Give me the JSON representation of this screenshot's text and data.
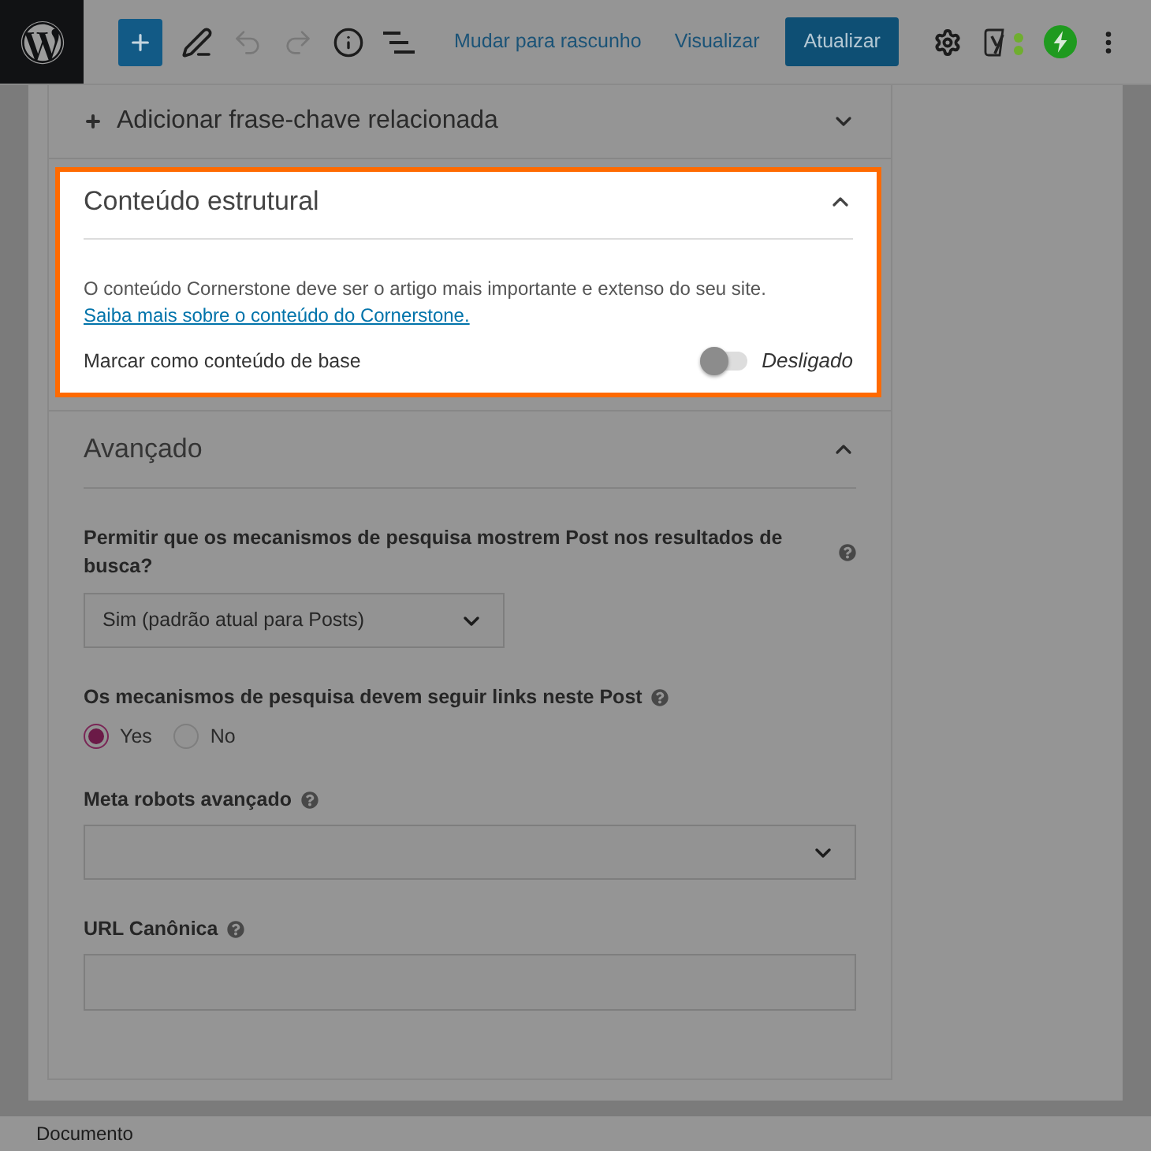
{
  "toolbar": {
    "tools": [
      {
        "kind": "edit",
        "disabled": false
      },
      {
        "kind": "undo",
        "disabled": true
      },
      {
        "kind": "redo",
        "disabled": true
      },
      {
        "kind": "info",
        "disabled": false
      },
      {
        "kind": "list",
        "disabled": false
      }
    ],
    "links": [
      {
        "label": "Mudar para rascunho"
      },
      {
        "label": "Visualizar"
      }
    ],
    "primary_button": {
      "label": "Atualizar"
    }
  },
  "sidebar": {
    "sections": [
      {
        "kind": "add_keyphrase",
        "title": "Adicionar frase-chave relacionada",
        "expanded": false,
        "highlighted": false
      },
      {
        "kind": "cornerstone",
        "title": "Conteúdo estrutural",
        "expanded": true,
        "highlighted": true,
        "description": "O conteúdo Cornerstone deve ser o artigo mais importante e extenso do seu site.",
        "link": "Saiba mais sobre o conteúdo do Cornerstone.",
        "toggle": {
          "label": "Marcar como conteúdo de base",
          "on": false,
          "state_text": "Desligado"
        }
      },
      {
        "kind": "advanced",
        "title": "Avançado",
        "expanded": true,
        "highlighted": false,
        "fields": [
          {
            "kind": "select",
            "label": "Permitir que os mecanismos de pesquisa mostrem Post nos resultados de busca?",
            "value": "Sim (padrão atual para Posts)"
          },
          {
            "kind": "radio",
            "label": "Os mecanismos de pesquisa devem seguir links neste Post",
            "options": [
              {
                "label": "Yes",
                "selected": true
              },
              {
                "label": "No",
                "selected": false
              }
            ]
          },
          {
            "kind": "multiselect",
            "label": "Meta robots avançado"
          },
          {
            "kind": "text",
            "label": "URL Canônica"
          }
        ]
      }
    ]
  },
  "status_bar": {
    "label": "Documento"
  }
}
